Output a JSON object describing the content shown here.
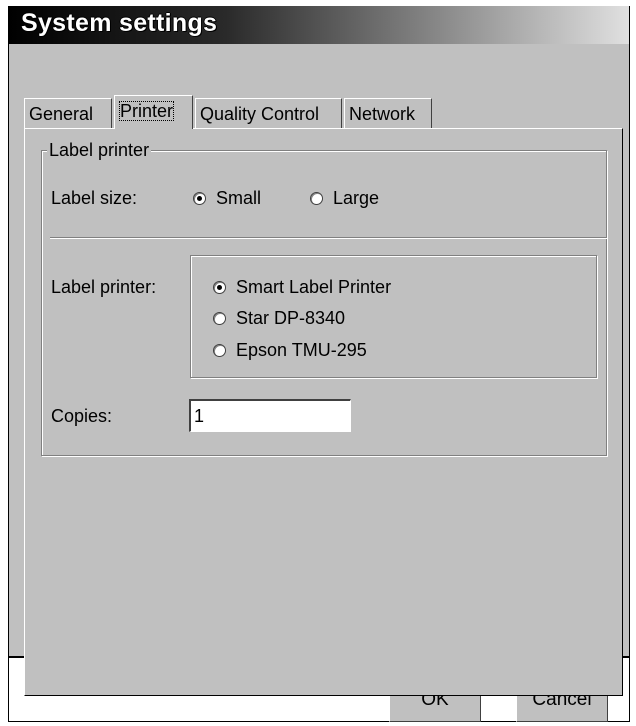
{
  "window": {
    "title": "System settings"
  },
  "tabs": [
    {
      "label": "General",
      "active": false
    },
    {
      "label": "Printer",
      "active": true
    },
    {
      "label": "Quality Control",
      "active": false
    },
    {
      "label": "Network",
      "active": false
    }
  ],
  "printer_panel": {
    "group_title": "Label printer",
    "label_size": {
      "label": "Label size:",
      "options": [
        {
          "label": "Small",
          "checked": true
        },
        {
          "label": "Large",
          "checked": false
        }
      ]
    },
    "label_printer": {
      "label": "Label printer:",
      "options": [
        {
          "label": "Smart Label Printer",
          "checked": true
        },
        {
          "label": "Star DP-8340",
          "checked": false
        },
        {
          "label": "Epson TMU-295",
          "checked": false
        }
      ]
    },
    "copies": {
      "label": "Copies:",
      "value": "1"
    }
  },
  "buttons": {
    "ok": "OK",
    "cancel": "Cancel"
  },
  "colors": {
    "panel_bg": "#c0c0c0",
    "title_text": "#ffffff"
  }
}
